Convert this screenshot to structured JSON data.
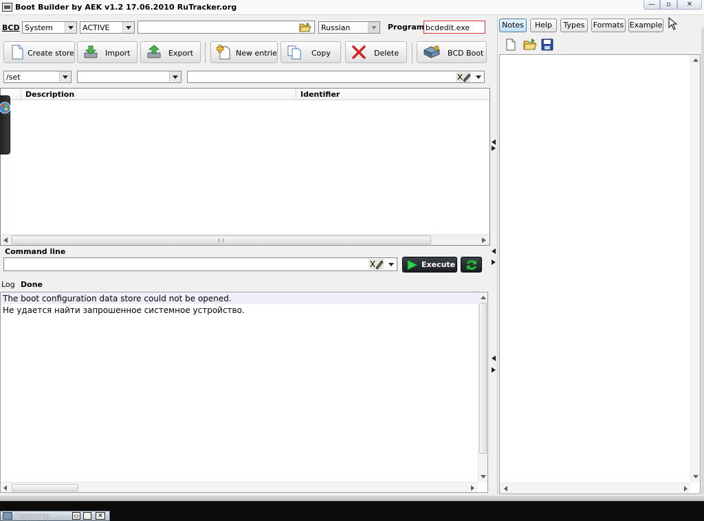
{
  "window": {
    "title": "Boot Builder by AEK  v1.2 17.06.2010  RuTracker.org",
    "controls": {
      "minimize": "—",
      "maximize": "▫",
      "close": "✕"
    }
  },
  "bcd_bar": {
    "bcd_label": "BCD",
    "store_value": "System",
    "mode_value": "ACTIVE",
    "path_value": "",
    "language_value": "Russian",
    "program_label": "Program",
    "program_value": "bcdedit.exe"
  },
  "toolbar": {
    "create_store": "Create store",
    "import": "Import",
    "export": "Export",
    "new_entrie": "New entrie",
    "copy": "Copy",
    "delete": "Delete",
    "bcd_boot": "BCD Boot"
  },
  "option_bar": {
    "switch_value": "/set",
    "type_value": "",
    "param_value": ""
  },
  "list": {
    "columns": [
      "",
      "Description",
      "Identifier"
    ],
    "rows": []
  },
  "command": {
    "label": "Command line",
    "value": "",
    "execute_label": "Execute"
  },
  "log": {
    "label": "Log",
    "status": "Done",
    "lines": [
      "The boot configuration data store could not be opened.",
      "Не удается найти запрошенное системное устройство."
    ]
  },
  "right_panel": {
    "tabs": [
      "Notes",
      "Help",
      "Types",
      "Formats",
      "Example"
    ],
    "active_tab": "Notes",
    "icons": [
      "new-file-icon",
      "open-folder-icon",
      "save-icon"
    ]
  },
  "taskbar": {
    "item_label": "Редактор"
  }
}
